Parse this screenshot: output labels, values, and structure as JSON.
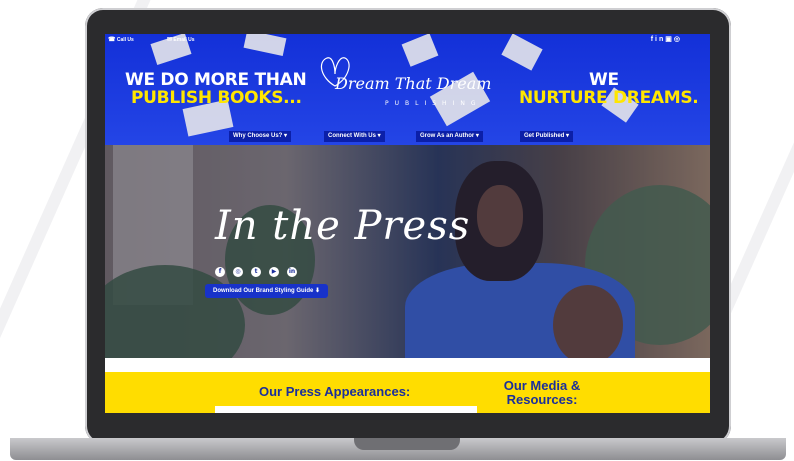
{
  "topbar": {
    "call_label": "Call Us",
    "email_label": "Email Us",
    "social_icons": [
      "facebook-icon",
      "linkedin-icon",
      "youtube-icon",
      "instagram-icon"
    ]
  },
  "header": {
    "headline_left_line1": "WE DO MORE THAN",
    "headline_left_line2": "PUBLISH BOOKS...",
    "headline_right_line1": "WE",
    "headline_right_line2": "NURTURE DREAMS.",
    "logo_script": "Dream That Dream",
    "logo_sub": "PUBLISHING",
    "nav": [
      {
        "label": "Why Choose Us? ▾"
      },
      {
        "label": "Connect With Us ▾"
      },
      {
        "label": "Grow As an Author ▾"
      },
      {
        "label": "Get Published ▾"
      }
    ]
  },
  "hero": {
    "title": "In the Press",
    "social_icons": [
      "facebook-icon",
      "instagram-icon",
      "twitter-icon",
      "youtube-icon",
      "linkedin-icon"
    ],
    "download_button": "Download Our Brand Styling Guide ⬇"
  },
  "sections": {
    "press_appearances": "Our Press Appearances:",
    "media_resources": "Our Media & Resources:"
  },
  "colors": {
    "brand_blue": "#1330d8",
    "brand_yellow": "#ffdd00",
    "heading_blue": "#1b2f9b"
  }
}
